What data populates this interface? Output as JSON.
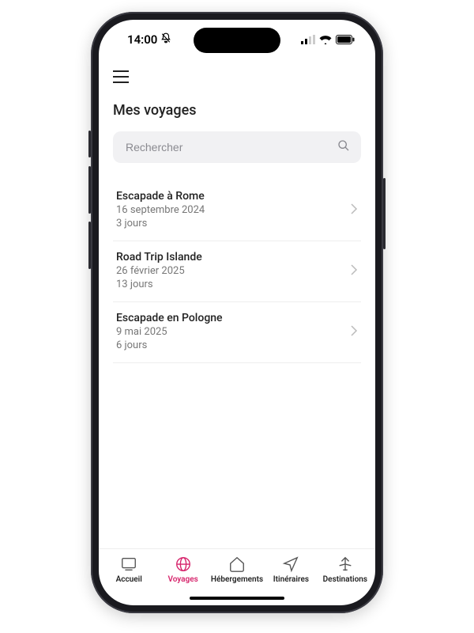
{
  "status": {
    "time": "14:00"
  },
  "header": {
    "title": "Mes voyages"
  },
  "search": {
    "placeholder": "Rechercher"
  },
  "trips": [
    {
      "title": "Escapade à Rome",
      "date": "16 septembre 2024",
      "duration": "3 jours"
    },
    {
      "title": "Road Trip Islande",
      "date": "26 février 2025",
      "duration": "13 jours"
    },
    {
      "title": "Escapade en Pologne",
      "date": "9 mai 2025",
      "duration": "6 jours"
    }
  ],
  "tabs": {
    "home": "Accueil",
    "trips": "Voyages",
    "lodging": "Hébergements",
    "itineraries": "Itinéraires",
    "destinations": "Destinations",
    "active": "trips"
  }
}
